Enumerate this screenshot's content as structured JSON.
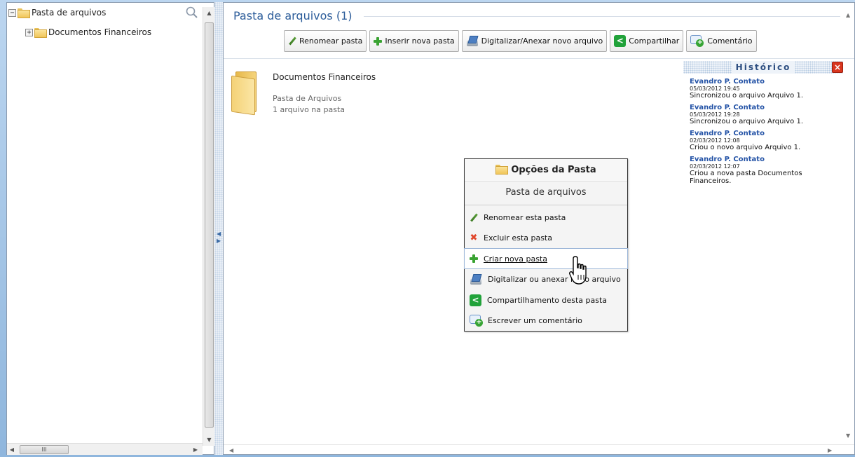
{
  "tree": {
    "root_label": "Pasta de arquivos",
    "root_toggle": "−",
    "child_label": "Documentos Financeiros",
    "child_toggle": "+",
    "hscroll_thumb": "III"
  },
  "main": {
    "title": "Pasta de arquivos (1)",
    "toolbar": {
      "rename": "Renomear pasta",
      "insert": "Inserir nova pasta",
      "scan": "Digitalizar/Anexar novo arquivo",
      "share": "Compartilhar",
      "comment": "Comentário"
    },
    "folder": {
      "name": "Documentos Financeiros",
      "type": "Pasta de Arquivos",
      "count": "1 arquivo na pasta"
    }
  },
  "history": {
    "title": "Histórico",
    "entries": [
      {
        "author": "Evandro P. Contato",
        "date": "05/03/2012 19:45",
        "action": "Sincronizou o arquivo Arquivo 1."
      },
      {
        "author": "Evandro P. Contato",
        "date": "05/03/2012 19:28",
        "action": "Sincronizou o arquivo Arquivo 1."
      },
      {
        "author": "Evandro P. Contato",
        "date": "02/03/2012 12:08",
        "action": "Criou o novo arquivo Arquivo 1."
      },
      {
        "author": "Evandro P. Contato",
        "date": "02/03/2012 12:07",
        "action": "Criou a nova pasta Documentos Financeiros."
      }
    ]
  },
  "popup": {
    "title": "Opções da Pasta",
    "subtitle": "Pasta de arquivos",
    "items": {
      "rename": "Renomear esta pasta",
      "delete": "Excluir esta pasta",
      "create": "Criar nova pasta",
      "scan": "Digitalizar ou anexar novo arquivo",
      "share": "Compartilhamento desta pasta",
      "comment": "Escrever um comentário"
    }
  },
  "colors": {
    "title_blue": "#2d5d9a",
    "author_blue": "#2453a6",
    "plus_green": "#3aa332",
    "share_green": "#21a23a",
    "close_red": "#d9361f"
  }
}
